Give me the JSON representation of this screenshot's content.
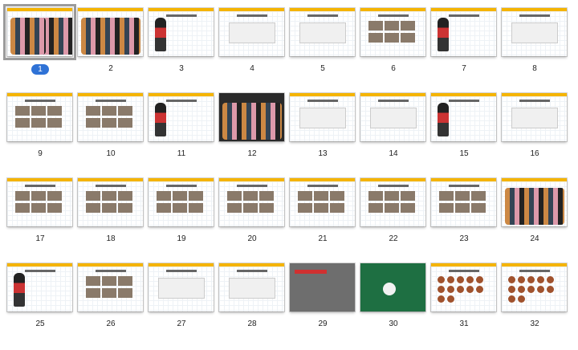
{
  "slides": [
    {
      "number": "1",
      "style": "cover",
      "selected": true
    },
    {
      "number": "2",
      "style": "crowd"
    },
    {
      "number": "3",
      "style": "figure"
    },
    {
      "number": "4",
      "style": "content"
    },
    {
      "number": "5",
      "style": "content"
    },
    {
      "number": "6",
      "style": "photos"
    },
    {
      "number": "7",
      "style": "figure"
    },
    {
      "number": "8",
      "style": "content"
    },
    {
      "number": "9",
      "style": "photos"
    },
    {
      "number": "10",
      "style": "photos"
    },
    {
      "number": "11",
      "style": "figure"
    },
    {
      "number": "12",
      "style": "dark"
    },
    {
      "number": "13",
      "style": "content"
    },
    {
      "number": "14",
      "style": "content"
    },
    {
      "number": "15",
      "style": "figure"
    },
    {
      "number": "16",
      "style": "content"
    },
    {
      "number": "17",
      "style": "photos"
    },
    {
      "number": "18",
      "style": "photos"
    },
    {
      "number": "19",
      "style": "photos"
    },
    {
      "number": "20",
      "style": "photos"
    },
    {
      "number": "21",
      "style": "photos"
    },
    {
      "number": "22",
      "style": "photos"
    },
    {
      "number": "23",
      "style": "photos"
    },
    {
      "number": "24",
      "style": "crowd"
    },
    {
      "number": "25",
      "style": "figure"
    },
    {
      "number": "26",
      "style": "photos"
    },
    {
      "number": "27",
      "style": "content"
    },
    {
      "number": "28",
      "style": "content"
    },
    {
      "number": "29",
      "style": "gray"
    },
    {
      "number": "30",
      "style": "green"
    },
    {
      "number": "31",
      "style": "faces"
    },
    {
      "number": "32",
      "style": "faces"
    }
  ],
  "colors": {
    "accent_bar": "#f5b400",
    "selection_badge": "#2f72d6",
    "selection_outline": "#9b9b9b"
  }
}
